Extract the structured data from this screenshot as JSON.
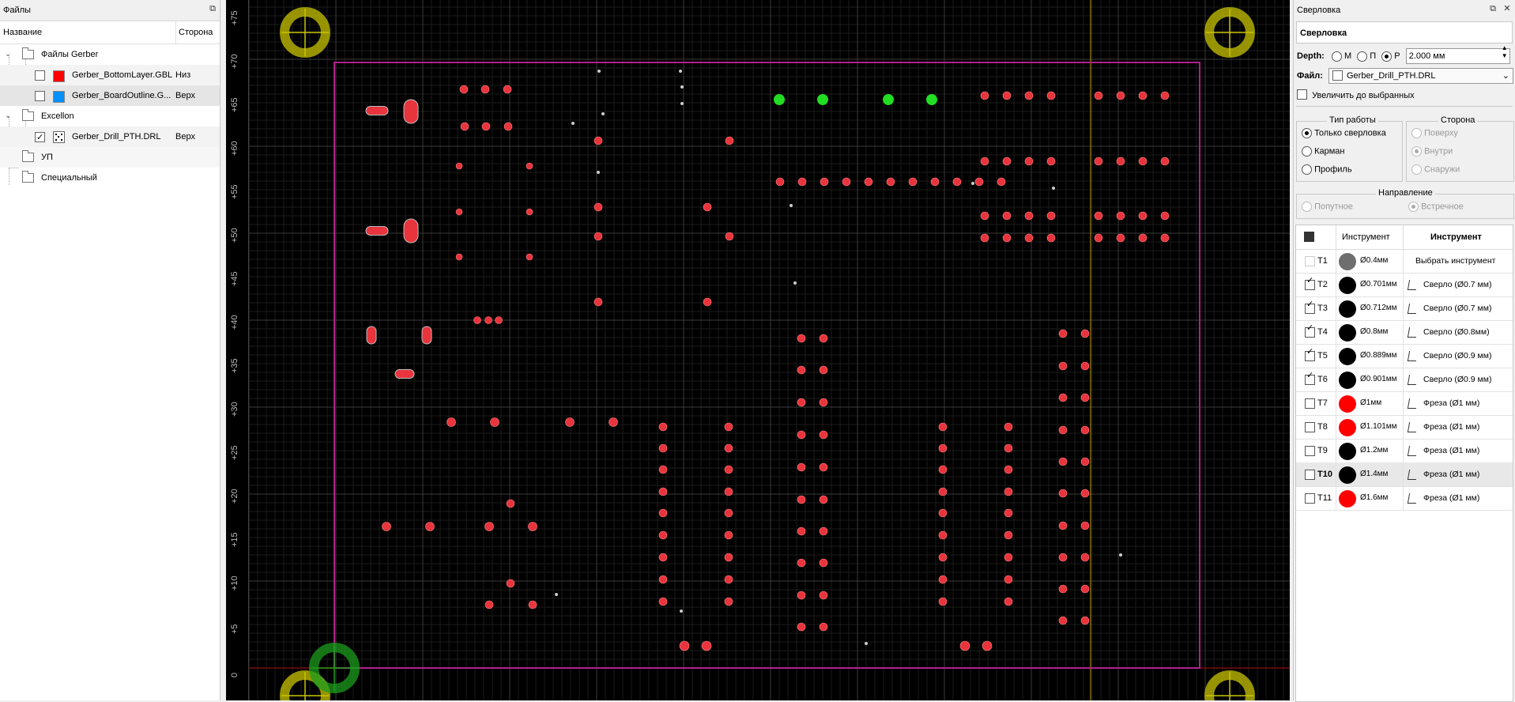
{
  "files_panel": {
    "title": "Файлы",
    "columns": {
      "name": "Название",
      "side": "Сторона"
    },
    "groups": [
      {
        "label": "Файлы Gerber",
        "items": [
          {
            "name": "Gerber_BottomLayer.GBL",
            "side": "Низ",
            "color": "#ff0000",
            "checked": false
          },
          {
            "name": "Gerber_BoardOutline.G...",
            "side": "Верх",
            "color": "#0090ff",
            "checked": false
          }
        ]
      },
      {
        "label": "Excellon",
        "items": [
          {
            "name": "Gerber_Drill_PTH.DRL",
            "side": "Верх",
            "checked": true
          }
        ]
      },
      {
        "label": "УП"
      },
      {
        "label": "Специальный"
      }
    ]
  },
  "ruler": {
    "labels": [
      "+75",
      "+70",
      "+65",
      "+60",
      "+55",
      "+50",
      "+45",
      "+40",
      "+35",
      "+30",
      "+25",
      "+20",
      "+15",
      "+10",
      "+5",
      "0"
    ]
  },
  "drill_panel": {
    "title": "Сверловка",
    "header": "Сверловка",
    "depth_label": "Depth:",
    "depth_modes": [
      "М",
      "П",
      "Р"
    ],
    "depth_selected": "Р",
    "depth_value": "2.000 мм",
    "file_label": "Файл:",
    "file_value": "Gerber_Drill_PTH.DRL",
    "zoom_selected_label": "Увеличить до выбранных",
    "work_type": {
      "title": "Тип работы",
      "options": [
        "Только сверловка",
        "Карман",
        "Профиль"
      ],
      "selected": "Только сверловка"
    },
    "side": {
      "title": "Сторона",
      "options": [
        "Поверху",
        "Внутри",
        "Снаружи"
      ],
      "selected": "Внутри"
    },
    "direction": {
      "title": "Направление",
      "options": [
        "Попутное",
        "Встречное"
      ],
      "selected": "Встречное"
    },
    "tools_table": {
      "col_tool": "Инструмент",
      "col_tool_bold": "Инструмент",
      "rows": [
        {
          "id": "T1",
          "dia": "Ø0.4мм",
          "tool": "Выбрать инструмент",
          "color": "#6e6e6e",
          "checked": false,
          "disabled": true,
          "icon": ""
        },
        {
          "id": "T2",
          "dia": "Ø0.701мм",
          "tool": "Сверло (Ø0.7 мм)",
          "color": "#000000",
          "checked": true,
          "icon": "drill"
        },
        {
          "id": "T3",
          "dia": "Ø0.712мм",
          "tool": "Сверло (Ø0.7 мм)",
          "color": "#000000",
          "checked": true,
          "icon": "drill"
        },
        {
          "id": "T4",
          "dia": "Ø0.8мм",
          "tool": "Сверло (Ø0.8мм)",
          "color": "#000000",
          "checked": true,
          "icon": "drill"
        },
        {
          "id": "T5",
          "dia": "Ø0.889мм",
          "tool": "Сверло (Ø0.9 мм)",
          "color": "#000000",
          "checked": true,
          "icon": "drill"
        },
        {
          "id": "T6",
          "dia": "Ø0.901мм",
          "tool": "Сверло (Ø0.9 мм)",
          "color": "#000000",
          "checked": true,
          "icon": "drill"
        },
        {
          "id": "T7",
          "dia": "Ø1мм",
          "tool": "Фреза (Ø1 мм)",
          "color": "#ff0000",
          "checked": false,
          "icon": "mill"
        },
        {
          "id": "T8",
          "dia": "Ø1.101мм",
          "tool": "Фреза (Ø1 мм)",
          "color": "#ff0000",
          "checked": false,
          "icon": "mill"
        },
        {
          "id": "T9",
          "dia": "Ø1.2мм",
          "tool": "Фреза (Ø1 мм)",
          "color": "#000000",
          "checked": false,
          "icon": "mill"
        },
        {
          "id": "T10",
          "dia": "Ø1.4мм",
          "tool": "Фреза (Ø1 мм)",
          "color": "#000000",
          "checked": false,
          "selected": true,
          "icon": "mill"
        },
        {
          "id": "T11",
          "dia": "Ø1.6мм",
          "tool": "Фреза (Ø1 мм)",
          "color": "#ff0000",
          "checked": false,
          "icon": "mill"
        }
      ]
    }
  },
  "colors": {
    "board_outline": "#b0208a",
    "pad": "#e8343c",
    "pad_green": "#22dd22",
    "target_yellow": "#c9c400",
    "target_green": "#1c9c1c",
    "cursor_line": "#c8a000"
  }
}
